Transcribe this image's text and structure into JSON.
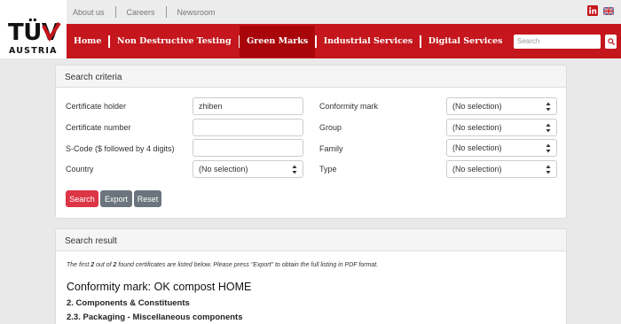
{
  "brand": {
    "name": "TÜV",
    "sub": "AUSTRIA",
    "accent": "#c4161c"
  },
  "utility": {
    "links": [
      "About us",
      "Careers",
      "Newsroom"
    ],
    "icons": [
      "linkedin-icon",
      "uk-flag-icon"
    ]
  },
  "nav": {
    "items": [
      "Home",
      "Non Destructive Testing",
      "Green Marks",
      "Industrial Services",
      "Digital Services"
    ],
    "active": "Green Marks",
    "search_placeholder": "Search"
  },
  "criteria": {
    "title": "Search criteria",
    "labels": {
      "holder": "Certificate holder",
      "number": "Certificate number",
      "scode": "S-Code ($ followed by 4 digits)",
      "country": "Country",
      "mark": "Conformity mark",
      "group": "Group",
      "family": "Family",
      "type": "Type"
    },
    "values": {
      "holder": "zhiben",
      "number": "",
      "scode": "",
      "country": "(No selection)",
      "mark": "(No selection)",
      "group": "(No selection)",
      "family": "(No selection)",
      "type": "(No selection)"
    },
    "buttons": {
      "search": "Search",
      "export": "Export",
      "reset": "Reset"
    }
  },
  "result": {
    "title": "Search result",
    "note_pre": "The first ",
    "note_n1": "2",
    "note_mid": " out of ",
    "note_n2": "2",
    "note_post": " found certificates are listed below. Please press \"Export\" to obtain the full listing in PDF format.",
    "heading": "Conformity mark: OK compost HOME",
    "section": "2. Components & Constituents",
    "subsection": "2.3. Packaging - Miscellaneous components"
  }
}
